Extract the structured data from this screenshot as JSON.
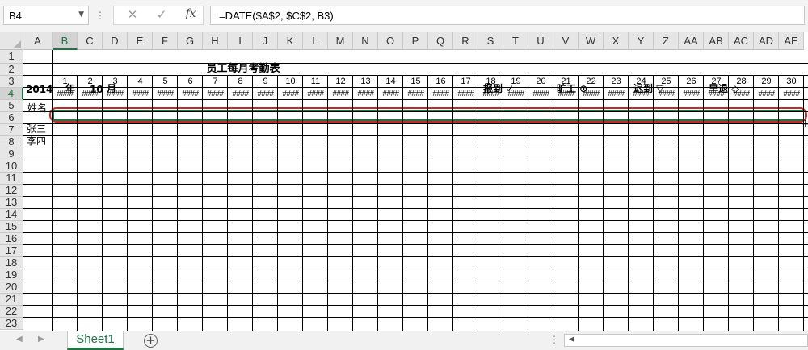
{
  "formula_bar": {
    "name_box": "B4",
    "separator": "⋮",
    "cancel_icon": "✕",
    "enter_icon": "✓",
    "fx_label": "fx",
    "formula": "=DATE($A$2, $C$2, B3)"
  },
  "columns": [
    "A",
    "B",
    "C",
    "D",
    "E",
    "F",
    "G",
    "H",
    "I",
    "J",
    "K",
    "L",
    "M",
    "N",
    "O",
    "P",
    "Q",
    "R",
    "S",
    "T",
    "U",
    "V",
    "W",
    "X",
    "Y",
    "Z",
    "AA",
    "AB",
    "AC",
    "AD",
    "AE"
  ],
  "rows": [
    "1",
    "2",
    "3",
    "4",
    "5",
    "6",
    "7",
    "8",
    "9",
    "10",
    "11",
    "12",
    "13",
    "14",
    "15",
    "16",
    "17",
    "18",
    "19",
    "20",
    "21",
    "22",
    "23"
  ],
  "selection": {
    "column": "B",
    "row": "4"
  },
  "sheet": {
    "title": "员工每月考勤表",
    "year": "2014",
    "year_label": "年",
    "month": "10",
    "month_label": "月",
    "legend_present": "报到 ✓",
    "legend_absent": "旷工 ⊙",
    "legend_late": "迟到 ▽",
    "legend_early": "早退 ◇",
    "name_header": "姓名",
    "days": [
      "1",
      "2",
      "3",
      "4",
      "5",
      "6",
      "7",
      "8",
      "9",
      "10",
      "11",
      "12",
      "13",
      "14",
      "15",
      "16",
      "17",
      "18",
      "19",
      "20",
      "21",
      "22",
      "23",
      "24",
      "25",
      "26",
      "27",
      "28",
      "29",
      "30"
    ],
    "date_cells": [
      "####",
      "####",
      "####",
      "####",
      "####",
      "####",
      "####",
      "####",
      "####",
      "####",
      "####",
      "####",
      "####",
      "####",
      "####",
      "####",
      "####",
      "####",
      "####",
      "####",
      "####",
      "####",
      "####",
      "####",
      "####",
      "####",
      "####",
      "####",
      "####",
      "####"
    ],
    "employees": [
      "张三",
      "李四"
    ]
  },
  "bottom_bar": {
    "nav_prev": "◀",
    "nav_next": "▶",
    "sheet_tab": "Sheet1",
    "add_sheet": "+",
    "dots": "⋮",
    "scroll_left": "◀"
  },
  "colors": {
    "excel_green": "#217346",
    "annotation_red": "#c62828",
    "header_gray": "#e6e6e6"
  }
}
